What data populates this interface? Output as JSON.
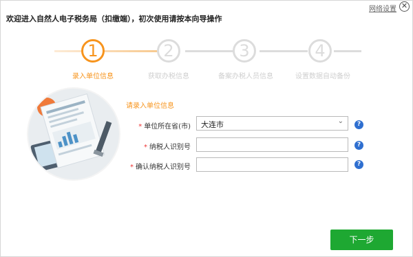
{
  "header": {
    "title": "欢迎进入自然人电子税务局（扣缴端），初次使用请按本向导操作",
    "network_settings": "网络设置",
    "close_symbol": "✕"
  },
  "steps": [
    {
      "number": "1",
      "label": "录入单位信息",
      "active": true
    },
    {
      "number": "2",
      "label": "获取办税信息",
      "active": false
    },
    {
      "number": "3",
      "label": "备案办税人员信息",
      "active": false
    },
    {
      "number": "4",
      "label": "设置数据自动备份",
      "active": false
    }
  ],
  "colors": {
    "accent": "#f7941d",
    "inactive": "#dcdcdc",
    "primary_button": "#1ea832",
    "help": "#2f6fd0",
    "required": "#e33333"
  },
  "form": {
    "section_title": "请录入单位信息",
    "required_mark": "*",
    "help_symbol": "?",
    "fields": [
      {
        "label": "单位所在省(市)",
        "value": "大连市",
        "type": "select"
      },
      {
        "label": "纳税人识别号",
        "value": "",
        "type": "input"
      },
      {
        "label": "确认纳税人识别号",
        "value": "",
        "type": "input"
      }
    ]
  },
  "footer": {
    "next_label": "下一步"
  }
}
